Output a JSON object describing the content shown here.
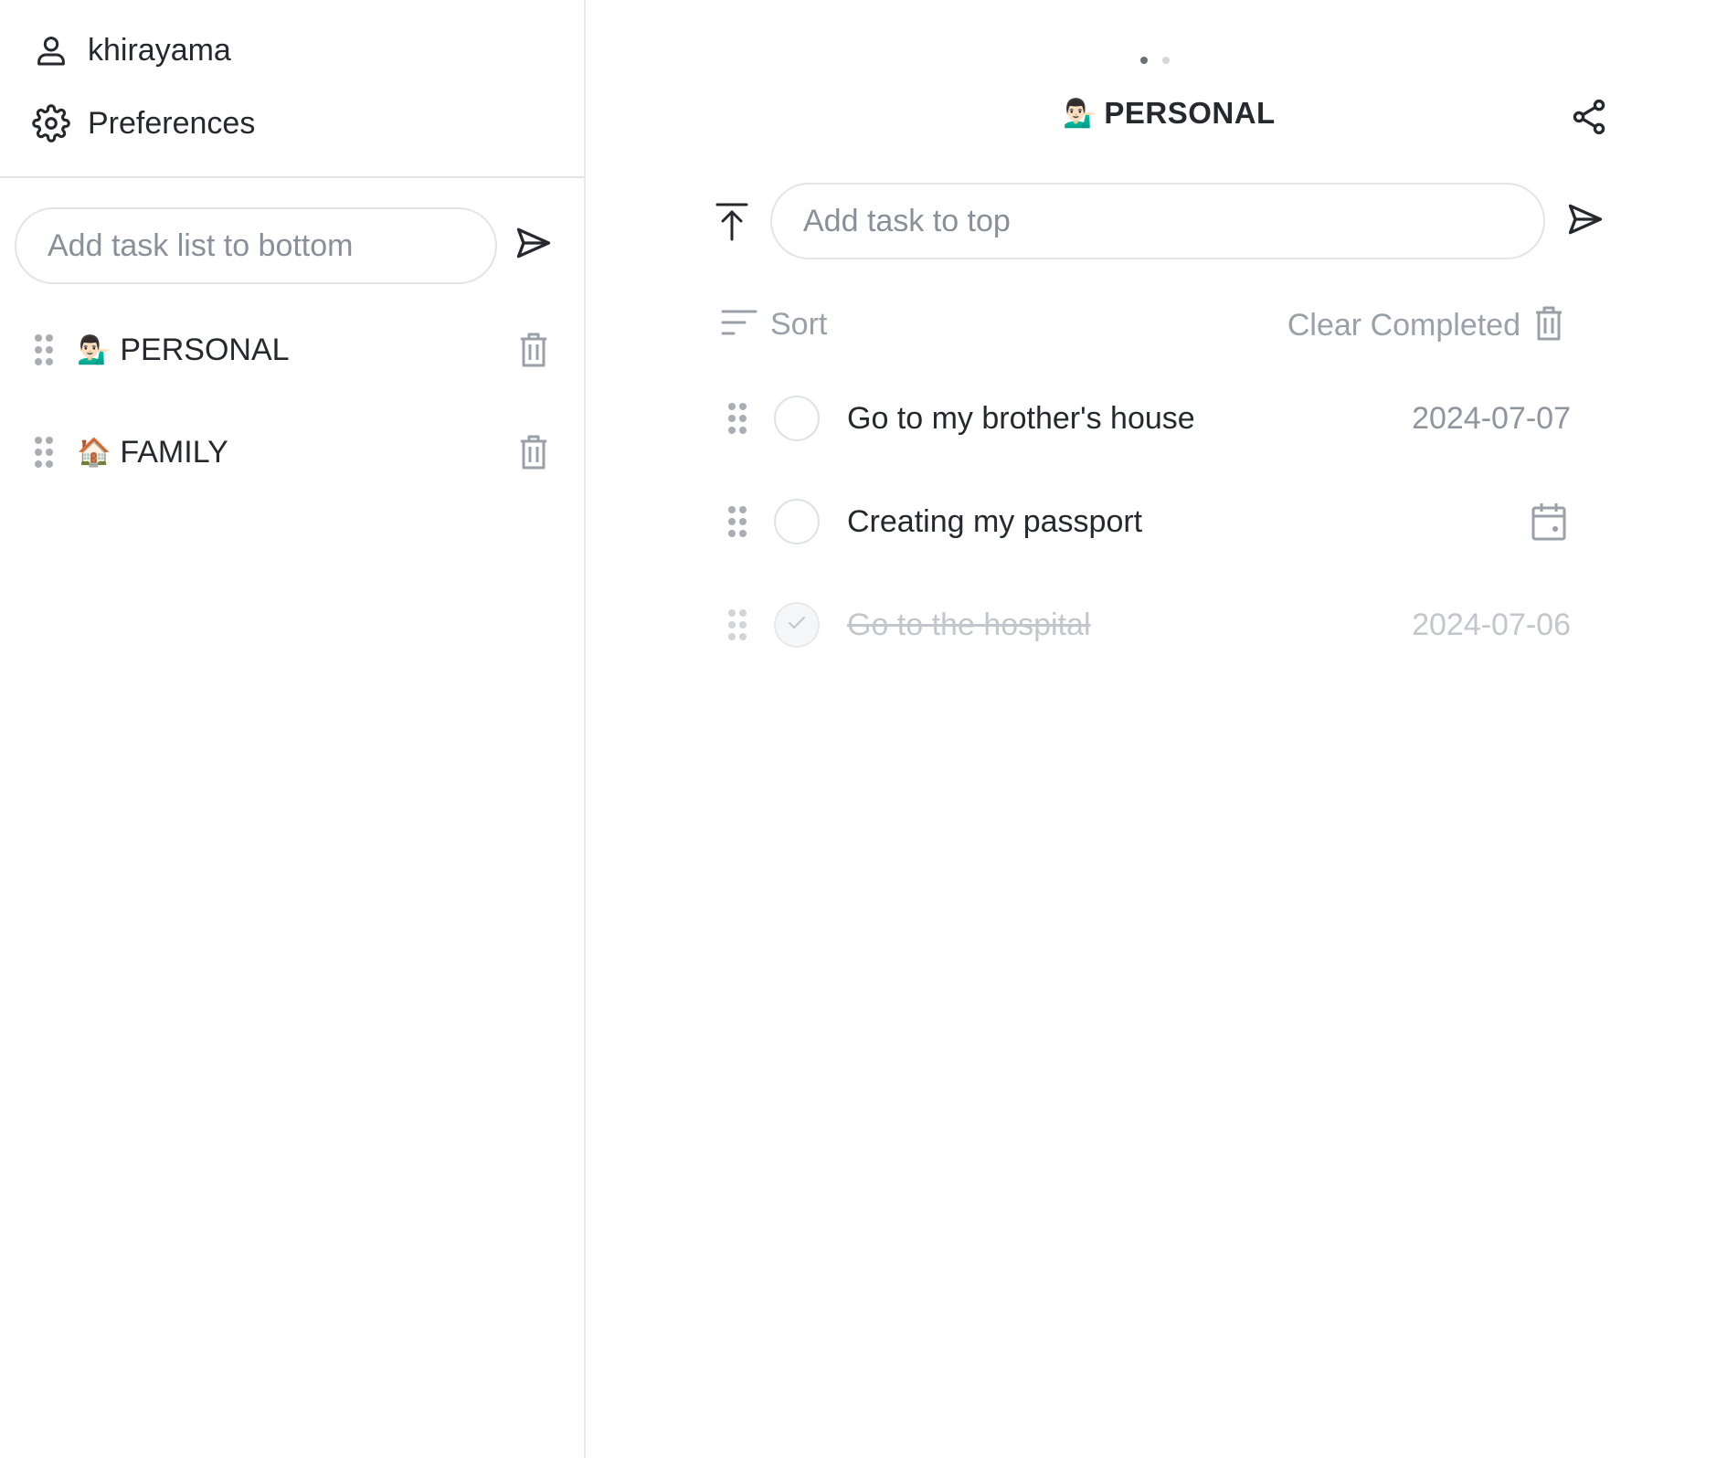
{
  "sidebar": {
    "user": {
      "name": "khirayama",
      "icon": "person-icon"
    },
    "preferences": {
      "label": "Preferences",
      "icon": "gear-icon"
    },
    "new_list": {
      "placeholder": "Add task list to bottom"
    },
    "lists": [
      {
        "emoji": "💁🏻‍♂️",
        "name": "PERSONAL"
      },
      {
        "emoji": "🏠",
        "name": "FAMILY"
      }
    ]
  },
  "main": {
    "page_indicator": {
      "count": 2,
      "active": 1
    },
    "list": {
      "emoji": "💁🏻‍♂️",
      "title": "PERSONAL"
    },
    "new_task": {
      "placeholder": "Add task to top"
    },
    "toolbar": {
      "sort_label": "Sort",
      "clear_label": "Clear Completed"
    },
    "tasks": [
      {
        "text": "Go to my brother's house",
        "date": "2024-07-07",
        "completed": false
      },
      {
        "text": "Creating my passport",
        "date": "",
        "completed": false
      },
      {
        "text": "Go to the hospital",
        "date": "2024-07-06",
        "completed": true
      }
    ]
  },
  "colors": {
    "text": "#25282d",
    "muted": "#9aa0a8",
    "border": "#e2e4e8",
    "completed": "#c3c6cc",
    "dot_active": "#6b7078",
    "dot_inactive": "#d5d7db"
  }
}
